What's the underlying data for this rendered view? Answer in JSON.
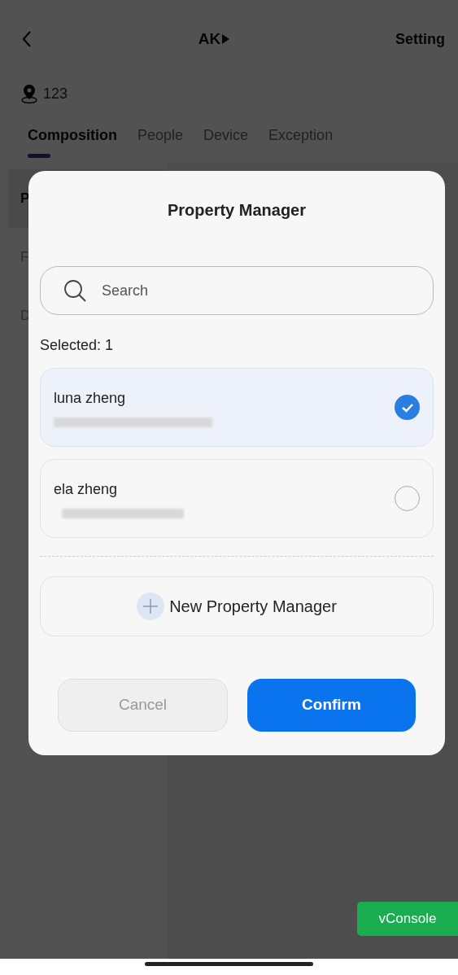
{
  "header": {
    "title": "AK",
    "action": "Setting"
  },
  "location": "123",
  "tabs": [
    {
      "label": "Composition",
      "selected": true
    },
    {
      "label": "People",
      "selected": false
    },
    {
      "label": "Device",
      "selected": false
    },
    {
      "label": "Exception",
      "selected": false
    }
  ],
  "sidebar_items": [
    {
      "label": "P",
      "selected": true
    },
    {
      "label": "F",
      "selected": false
    },
    {
      "label": "D",
      "selected": false
    }
  ],
  "dialog": {
    "title": "Property Manager",
    "search": {
      "placeholder": "Search"
    },
    "selected_count": "Selected: 1",
    "people": [
      {
        "name": "luna zheng",
        "selected": true
      },
      {
        "name": "ela zheng",
        "selected": false
      }
    ],
    "add_button": "New Property Manager",
    "cancel": "Cancel",
    "confirm": "Confirm"
  },
  "vconsole": "vConsole"
}
